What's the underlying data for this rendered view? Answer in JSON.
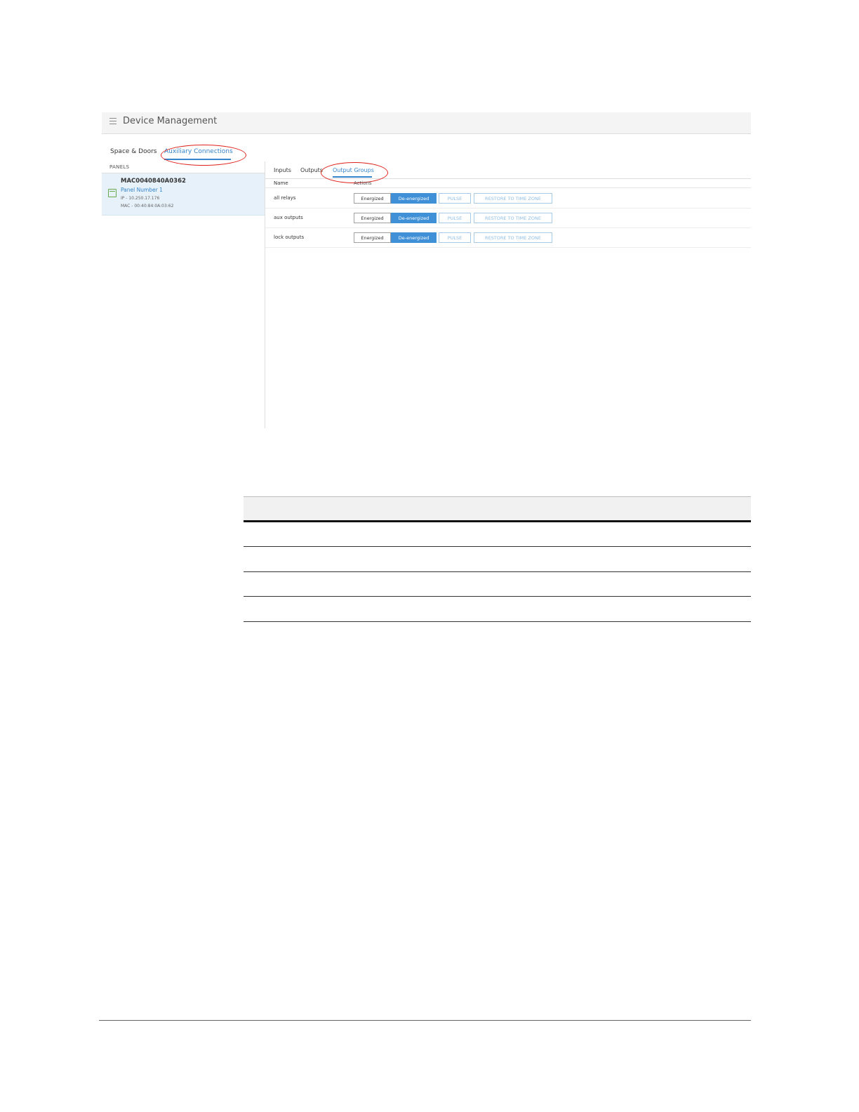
{
  "app": {
    "title": "Device Management"
  },
  "top_tabs": [
    {
      "label": "Space & Doors",
      "active": false
    },
    {
      "label": "Auxiliary Connections",
      "active": true
    }
  ],
  "panels": {
    "heading": "PANELS",
    "items": [
      {
        "name": "MAC0040840A0362",
        "panel_label": "Panel Number 1",
        "ip": "IP - 10.250.17.176",
        "mac": "MAC - 00:40:84:0A:03:62"
      }
    ]
  },
  "sub_tabs": [
    {
      "label": "Inputs",
      "active": false
    },
    {
      "label": "Outputs",
      "active": false
    },
    {
      "label": "Output Groups",
      "active": true
    }
  ],
  "columns": {
    "name": "Name",
    "actions": "Actions"
  },
  "output_groups": [
    {
      "name": "all relays"
    },
    {
      "name": "aux outputs"
    },
    {
      "name": "lock outputs"
    }
  ],
  "actions": {
    "energized": "Energized",
    "de_energized": "De-energized",
    "pulse": "PULSE",
    "restore": "RESTORE TO TIME ZONE"
  },
  "colors": {
    "accent": "#3f90d6",
    "highlight_circle": "#e0211b",
    "selected_panel_bg": "#e6f1fa"
  }
}
